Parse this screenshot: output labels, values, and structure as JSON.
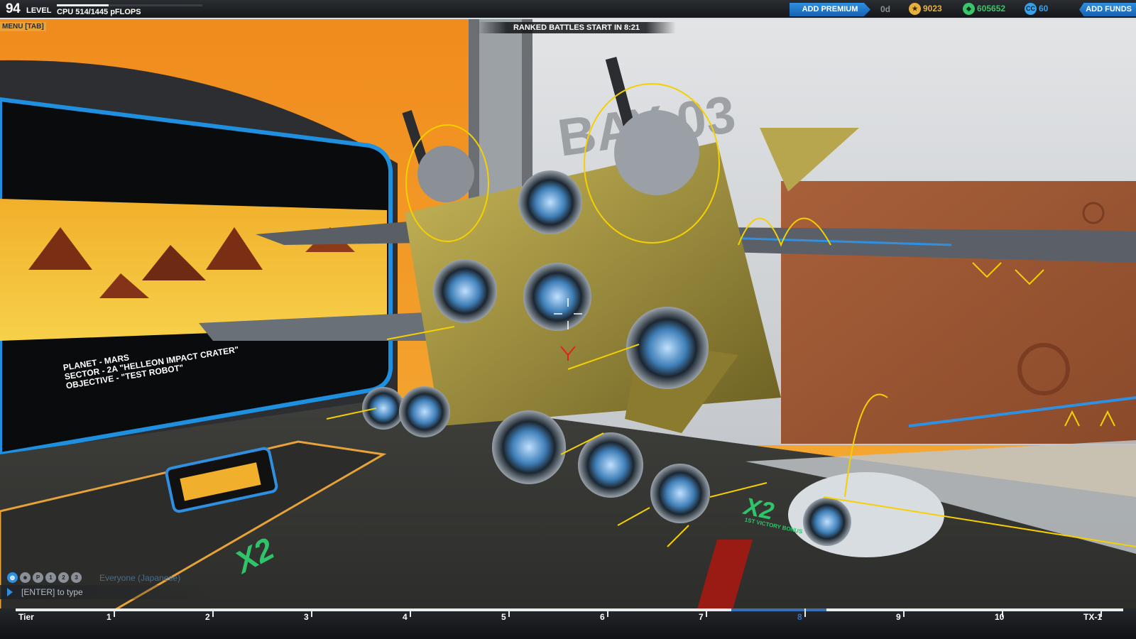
{
  "top_bar": {
    "level_number": "94",
    "level_label": "LEVEL",
    "cpu_text": "CPU 514/1445 pFLOPS",
    "cpu_fraction": 0.356,
    "add_premium_label": "ADD PREMIUM",
    "premium_days": "0d",
    "currencies": [
      {
        "icon": "robits-icon",
        "value": "9023",
        "color": "#e8b23a"
      },
      {
        "icon": "rp-icon",
        "value": "605652",
        "color": "#3cc46a"
      },
      {
        "icon": "cosmetic-credits-icon",
        "value": "60",
        "color": "#3aa0e8"
      }
    ],
    "cc_icon_text": "CC",
    "add_funds_label": "ADD FUNDS"
  },
  "menu_tab_label": "MENU [TAB]",
  "ranked_banner": "RANKED BATTLES START IN 8:21",
  "screen": {
    "line1": "PLANET - MARS",
    "line2": "SECTOR - 2A \"HELLEON IMPACT CRATER\"",
    "line3": "OBJECTIVE - \"TEST ROBOT\""
  },
  "floor_texts": {
    "multiplier": "X2",
    "bay_label": "BAY 03",
    "victory": "1ST VICTORY BONUS"
  },
  "chat": {
    "channel": "Everyone (Japanese)",
    "placeholder": "[ENTER] to type",
    "icons": [
      "globe-icon",
      "person-icon",
      "party-icon",
      "clan-icon-1",
      "clan-icon-2",
      "clan-icon-3"
    ],
    "icon_texts": [
      "",
      "",
      "P",
      "1",
      "2",
      "3"
    ]
  },
  "tier_bar": {
    "label_start": "Tier",
    "tiers": [
      "1",
      "2",
      "3",
      "4",
      "5",
      "6",
      "7",
      "8",
      "9",
      "10",
      "TX-1"
    ],
    "active_tier": "8",
    "colors": {
      "inactive": "#ffffff",
      "active": "#3b6fb5"
    }
  }
}
